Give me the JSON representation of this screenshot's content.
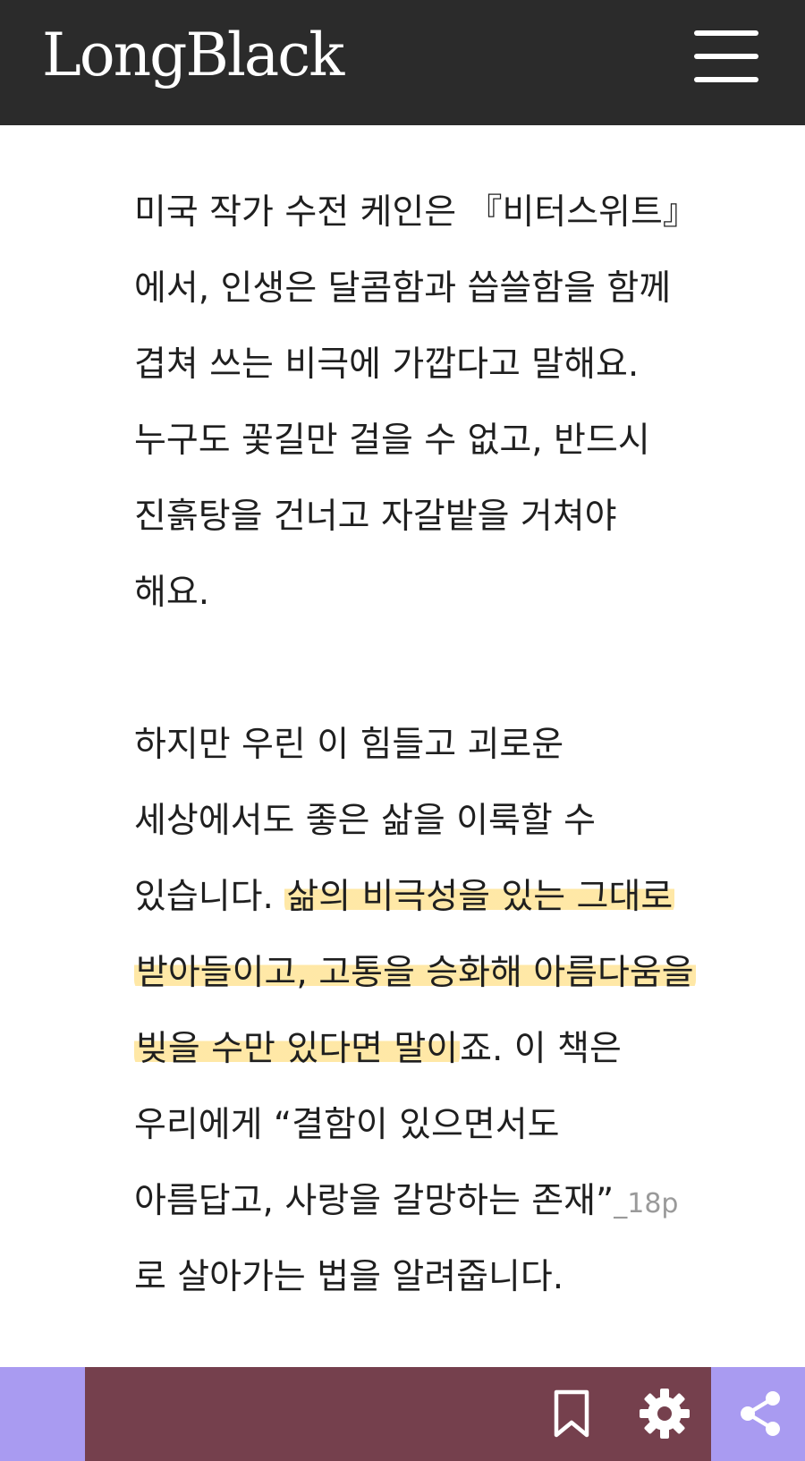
{
  "header": {
    "logo": "LongBlack",
    "menu_icon": "hamburger-menu-icon"
  },
  "article": {
    "paragraph1": {
      "lines": [
        "미국 작가 수전 케인은 『비터스위트』",
        "에서, 인생은 달콤함과 씁쓸함을 함께",
        "겹쳐 쓰는 비극에 가깝다고 말해요.",
        "누구도 꽃길만 걸을 수 없고, 반드시",
        "진흙탕을 건너고 자갈밭을 거쳐야",
        "해요."
      ]
    },
    "paragraph2": {
      "line1": "하지만 우린 이 힘들고 괴로운",
      "line2": "세상에서도 좋은 삶을 이룩할 수",
      "line3_plain": "있습니다. ",
      "line3_hl": "삶의 비극성을 있는 그대로",
      "line4_hl": "받아들이고, 고통을 승화해 아름다움을",
      "line5_hl": "빚을 수만 있다면 말이",
      "line5_plain": "죠. 이 책은",
      "line6": "우리에게 “결함이 있으면서도",
      "line7": "아름답고, 사랑을 갈망하는 존재”",
      "line7_ref": "_18p",
      "line8": "로 살아가는 법을 알려줍니다."
    },
    "highlight_color": "#FFD65E"
  },
  "toolbar": {
    "left_color": "#A99BF1",
    "middle_color": "#75404D",
    "right_color": "#A99BF1",
    "icons": [
      "bookmark-icon",
      "gear-icon",
      "share-icon"
    ]
  }
}
